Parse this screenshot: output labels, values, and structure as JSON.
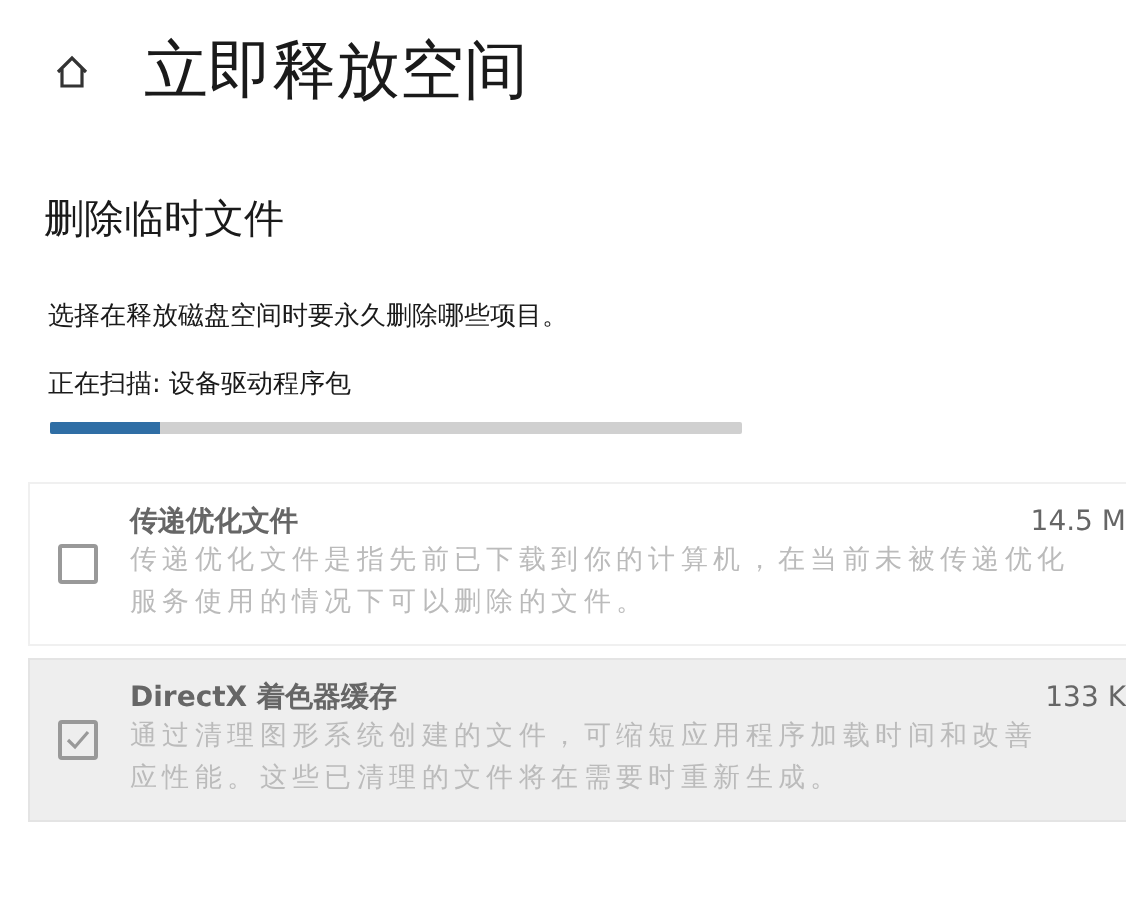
{
  "page": {
    "title": "立即释放空间"
  },
  "section": {
    "title": "删除临时文件",
    "description": "选择在释放磁盘空间时要永久删除哪些项目。",
    "status": "正在扫描: 设备驱动程序包",
    "level": 0.16
  },
  "items": [
    {
      "title": "传递优化文件",
      "size": "14.5 M",
      "description_lines": [
        "传递优化文件是指先前已下载到你的计算机，在当前未被传递优化",
        "服务使用的情况下可以删除的文件。"
      ],
      "checked": false,
      "disabled": true,
      "highlighted": false
    },
    {
      "title": "DirectX 着色器缓存",
      "size": "133 K",
      "description_lines": [
        "通过清理图形系统创建的文件，可缩短应用程序加载时间和改善",
        "应性能。这些已清理的文件将在需要时重新生成。"
      ],
      "checked": true,
      "disabled": true,
      "highlighted": true
    }
  ]
}
